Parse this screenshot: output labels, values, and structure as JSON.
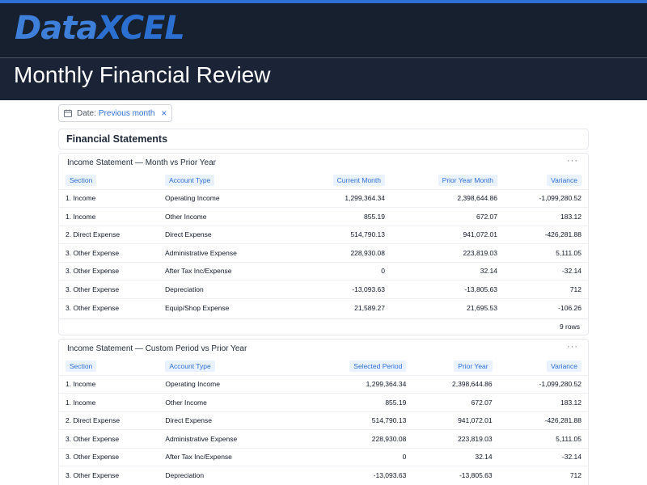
{
  "header": {
    "logo_part1": "Data",
    "logo_part2": "XCEL",
    "title": "Monthly Financial Review"
  },
  "filter": {
    "label": "Date:",
    "value": "Previous month",
    "close": "×"
  },
  "section": {
    "title": "Financial Statements"
  },
  "cards": [
    {
      "title": "Income Statement — Month vs Prior Year",
      "more": "···",
      "columns": [
        "Section",
        "Account Type",
        "Current Month",
        "Prior Year Month",
        "Variance"
      ],
      "rows": [
        [
          "1. Income",
          "Operating Income",
          "1,299,364.34",
          "2,398,644.86",
          "-1,099,280.52"
        ],
        [
          "1. Income",
          "Other Income",
          "855.19",
          "672.07",
          "183.12"
        ],
        [
          "2. Direct Expense",
          "Direct Expense",
          "514,790.13",
          "941,072.01",
          "-426,281.88"
        ],
        [
          "3. Other Expense",
          "Administrative Expense",
          "228,930.08",
          "223,819.03",
          "5,111.05"
        ],
        [
          "3. Other Expense",
          "After Tax Inc/Expense",
          "0",
          "32.14",
          "-32.14"
        ],
        [
          "3. Other Expense",
          "Depreciation",
          "-13,093.63",
          "-13,805.63",
          "712"
        ],
        [
          "3. Other Expense",
          "Equip/Shop Expense",
          "21,589.27",
          "21,695.53",
          "-106.26"
        ]
      ],
      "footer": "9 rows"
    },
    {
      "title": "Income Statement — Custom Period vs Prior Year",
      "more": "···",
      "columns": [
        "Section",
        "Account Type",
        "Selected Period",
        "Prior Year",
        "Variance"
      ],
      "rows": [
        [
          "1. Income",
          "Operating Income",
          "1,299,364.34",
          "2,398,644.86",
          "-1,099,280.52"
        ],
        [
          "1. Income",
          "Other Income",
          "855.19",
          "672.07",
          "183.12"
        ],
        [
          "2. Direct Expense",
          "Direct Expense",
          "514,790.13",
          "941,072.01",
          "-426,281.88"
        ],
        [
          "3. Other Expense",
          "Administrative Expense",
          "228,930.08",
          "223,819.03",
          "5,111.05"
        ],
        [
          "3. Other Expense",
          "After Tax Inc/Expense",
          "0",
          "32.14",
          "-32.14"
        ],
        [
          "3. Other Expense",
          "Depreciation",
          "-13,093.63",
          "-13,805.63",
          "712"
        ]
      ]
    }
  ],
  "colors": {
    "accent": "#2f6fd6",
    "header_bg": "#1b2436",
    "header_chip_bg": "#eaf2fd"
  }
}
